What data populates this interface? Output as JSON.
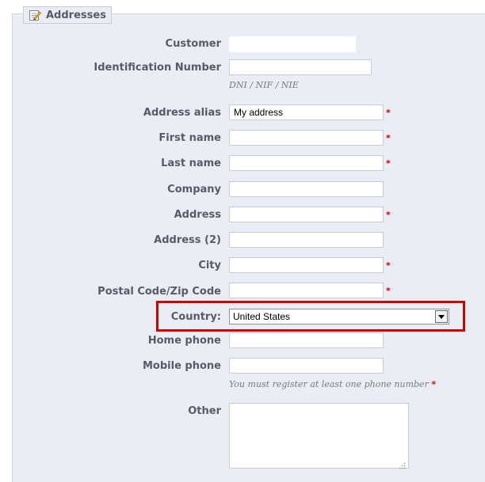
{
  "section": {
    "title": "Addresses",
    "icon": "edit-note-icon"
  },
  "fields": {
    "customer": {
      "label": "Customer",
      "value": ""
    },
    "identification": {
      "label": "Identification Number",
      "value": "",
      "hint": "DNI / NIF / NIE"
    },
    "alias": {
      "label": "Address alias",
      "value": "My address"
    },
    "first_name": {
      "label": "First name",
      "value": ""
    },
    "last_name": {
      "label": "Last name",
      "value": ""
    },
    "company": {
      "label": "Company",
      "value": ""
    },
    "address": {
      "label": "Address",
      "value": ""
    },
    "address2": {
      "label": "Address (2)",
      "value": ""
    },
    "city": {
      "label": "City",
      "value": ""
    },
    "postcode": {
      "label": "Postal Code/Zip Code",
      "value": ""
    },
    "country": {
      "label": "Country:",
      "value": "United States"
    },
    "home_phone": {
      "label": "Home phone",
      "value": ""
    },
    "mobile_phone": {
      "label": "Mobile phone",
      "value": "",
      "hint": "You must register at least one phone number"
    },
    "other": {
      "label": "Other",
      "value": ""
    }
  },
  "required_mark": "*",
  "colors": {
    "panel_bg": "#ebedf4",
    "label_text": "#585a69",
    "required": "#cc0000",
    "highlight_box": "#d40000"
  }
}
